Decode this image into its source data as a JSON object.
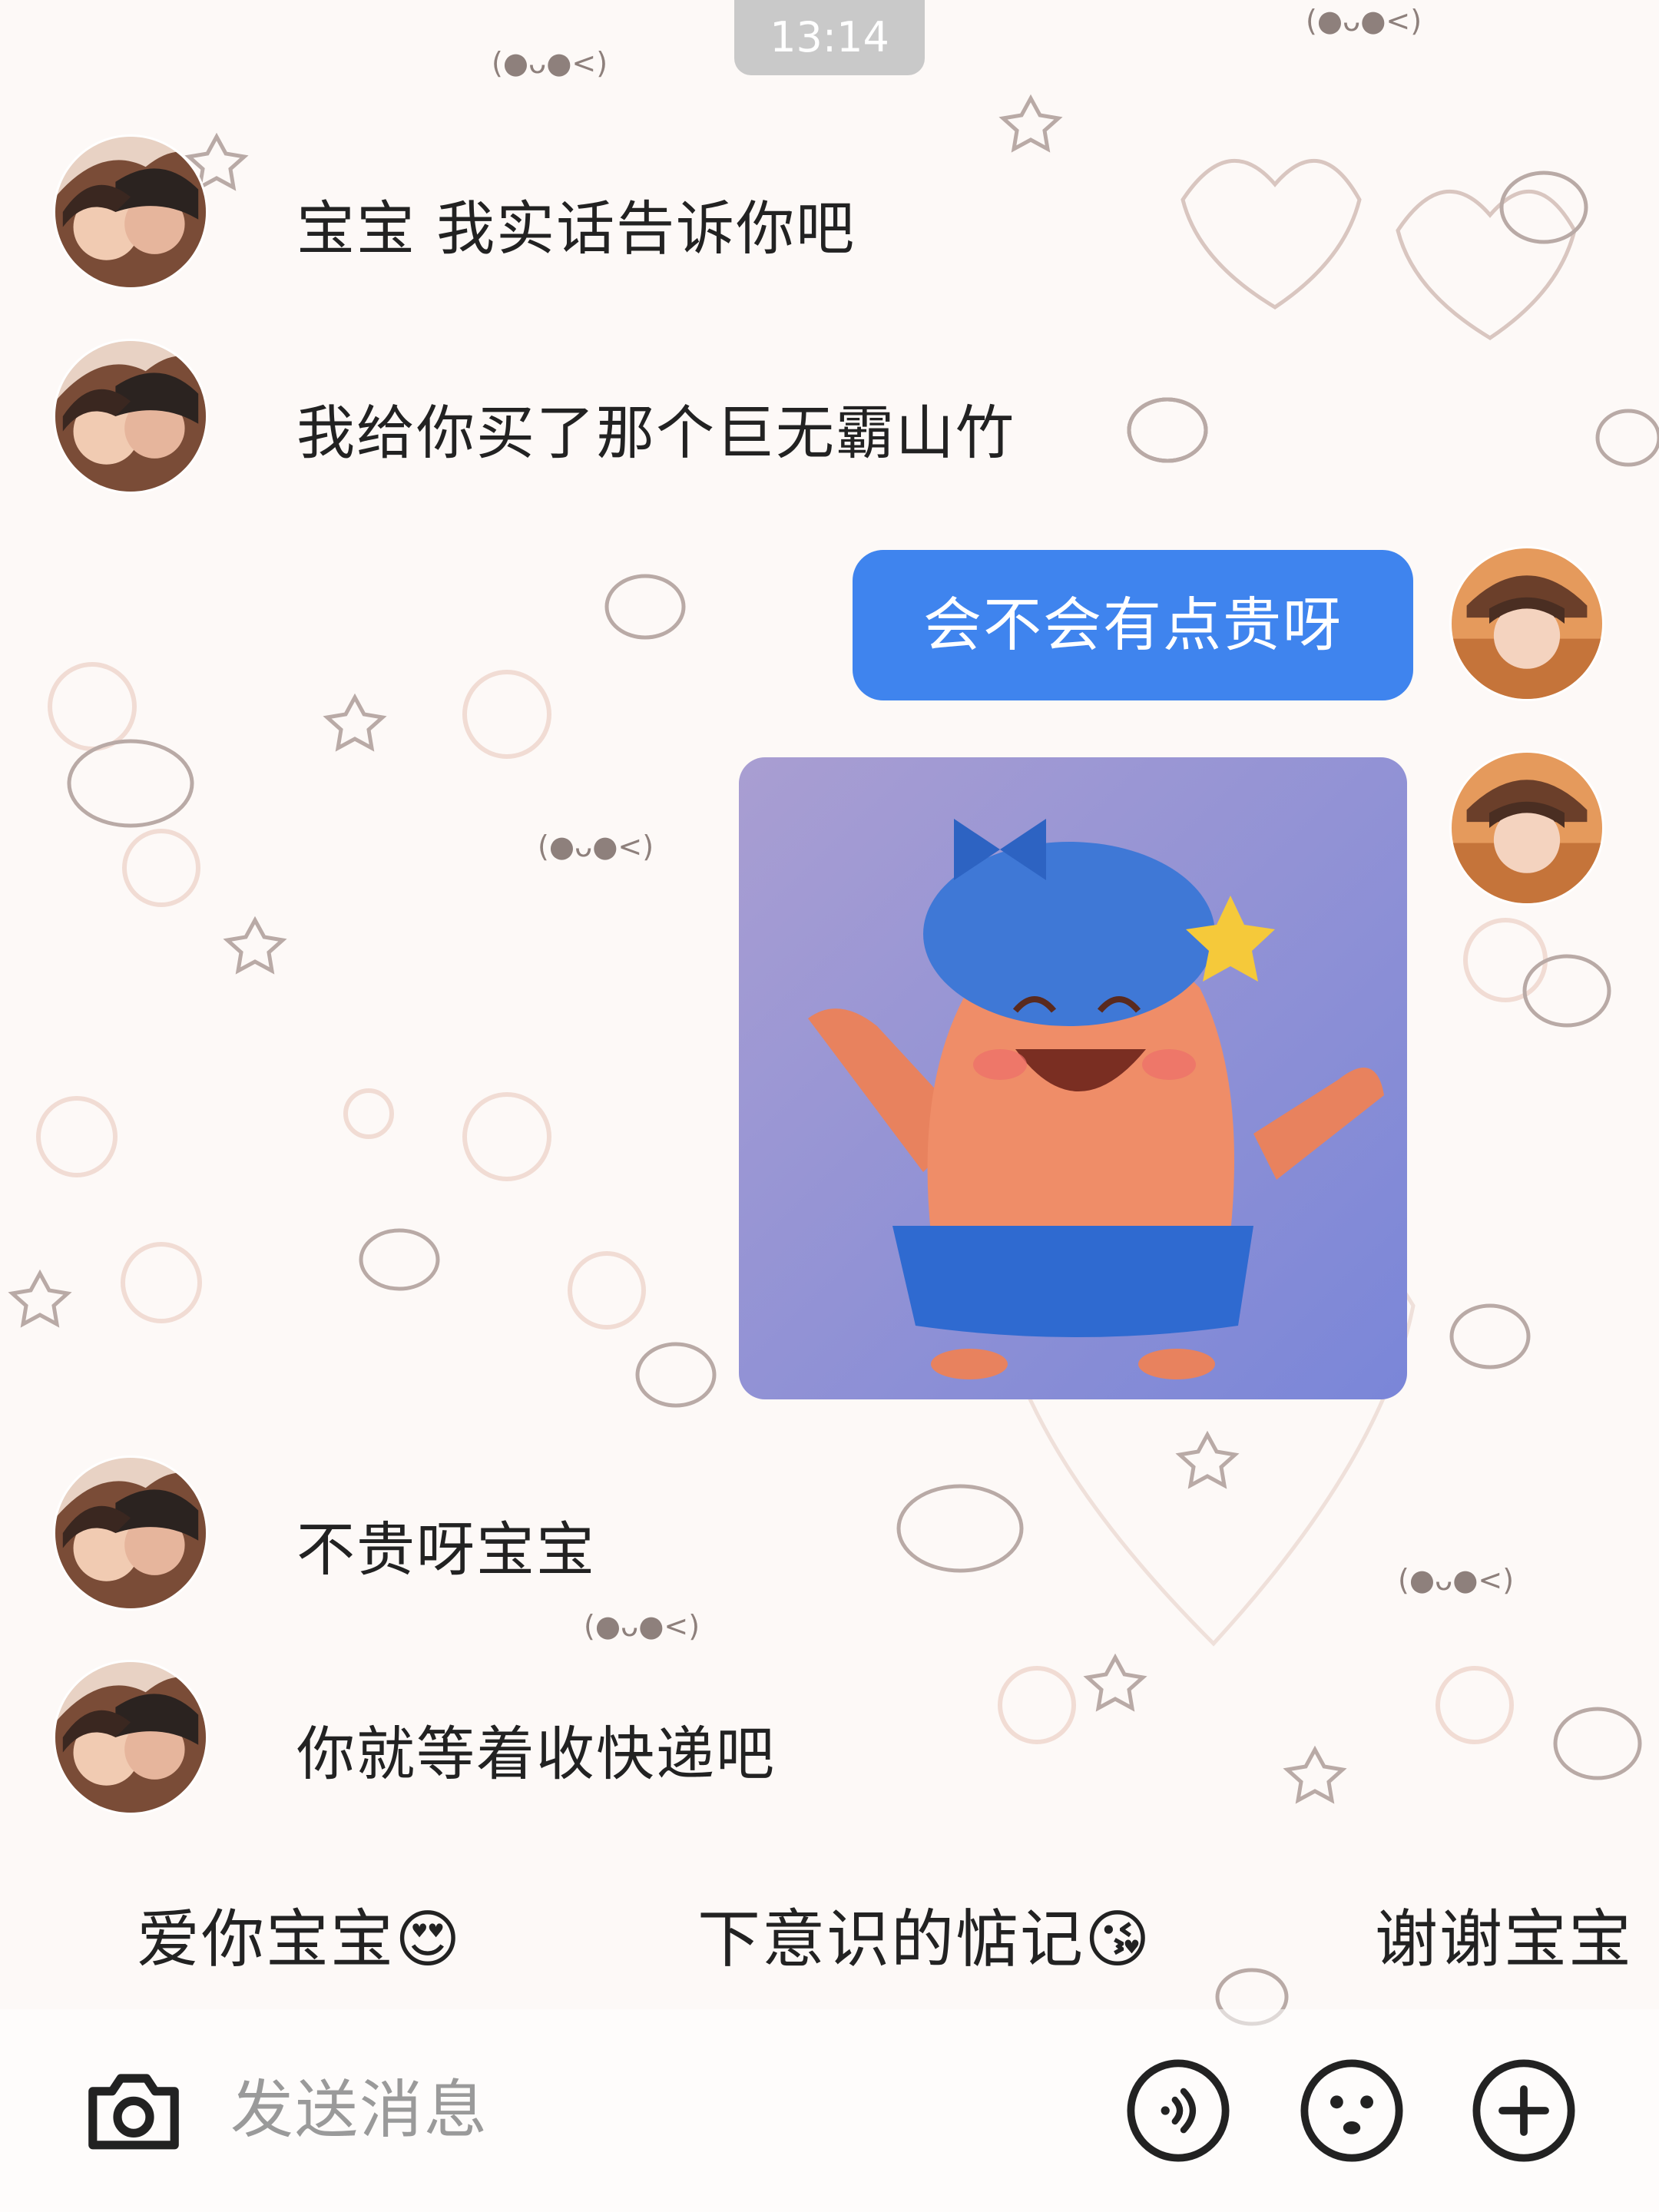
{
  "status": {
    "time": "13:14"
  },
  "chat": {
    "messages": [
      {
        "side": "left",
        "text": "宝宝 我实话告诉你吧"
      },
      {
        "side": "left",
        "text": "我给你买了那个巨无霸山竹"
      },
      {
        "side": "right",
        "text": "会不会有点贵呀"
      },
      {
        "side": "right",
        "type": "sticker",
        "sticker": "patrick-star-smiling-with-blue-cap"
      },
      {
        "side": "left",
        "text": "不贵呀宝宝"
      },
      {
        "side": "left",
        "text": "你就等着收快递吧"
      }
    ]
  },
  "quick_replies": [
    "爱你宝宝😍",
    "下意识的惦记😘",
    "谢谢宝宝"
  ],
  "input": {
    "placeholder": "发送消息"
  },
  "icons": {
    "camera": "camera-icon",
    "voice": "voice-icon",
    "emoji": "emoji-icon",
    "add": "plus-icon"
  },
  "colors": {
    "bubble": "#3f84ee",
    "text": "#222222",
    "placeholder": "#9a9a9a",
    "timestamp_bg": "#c9c9c9"
  }
}
